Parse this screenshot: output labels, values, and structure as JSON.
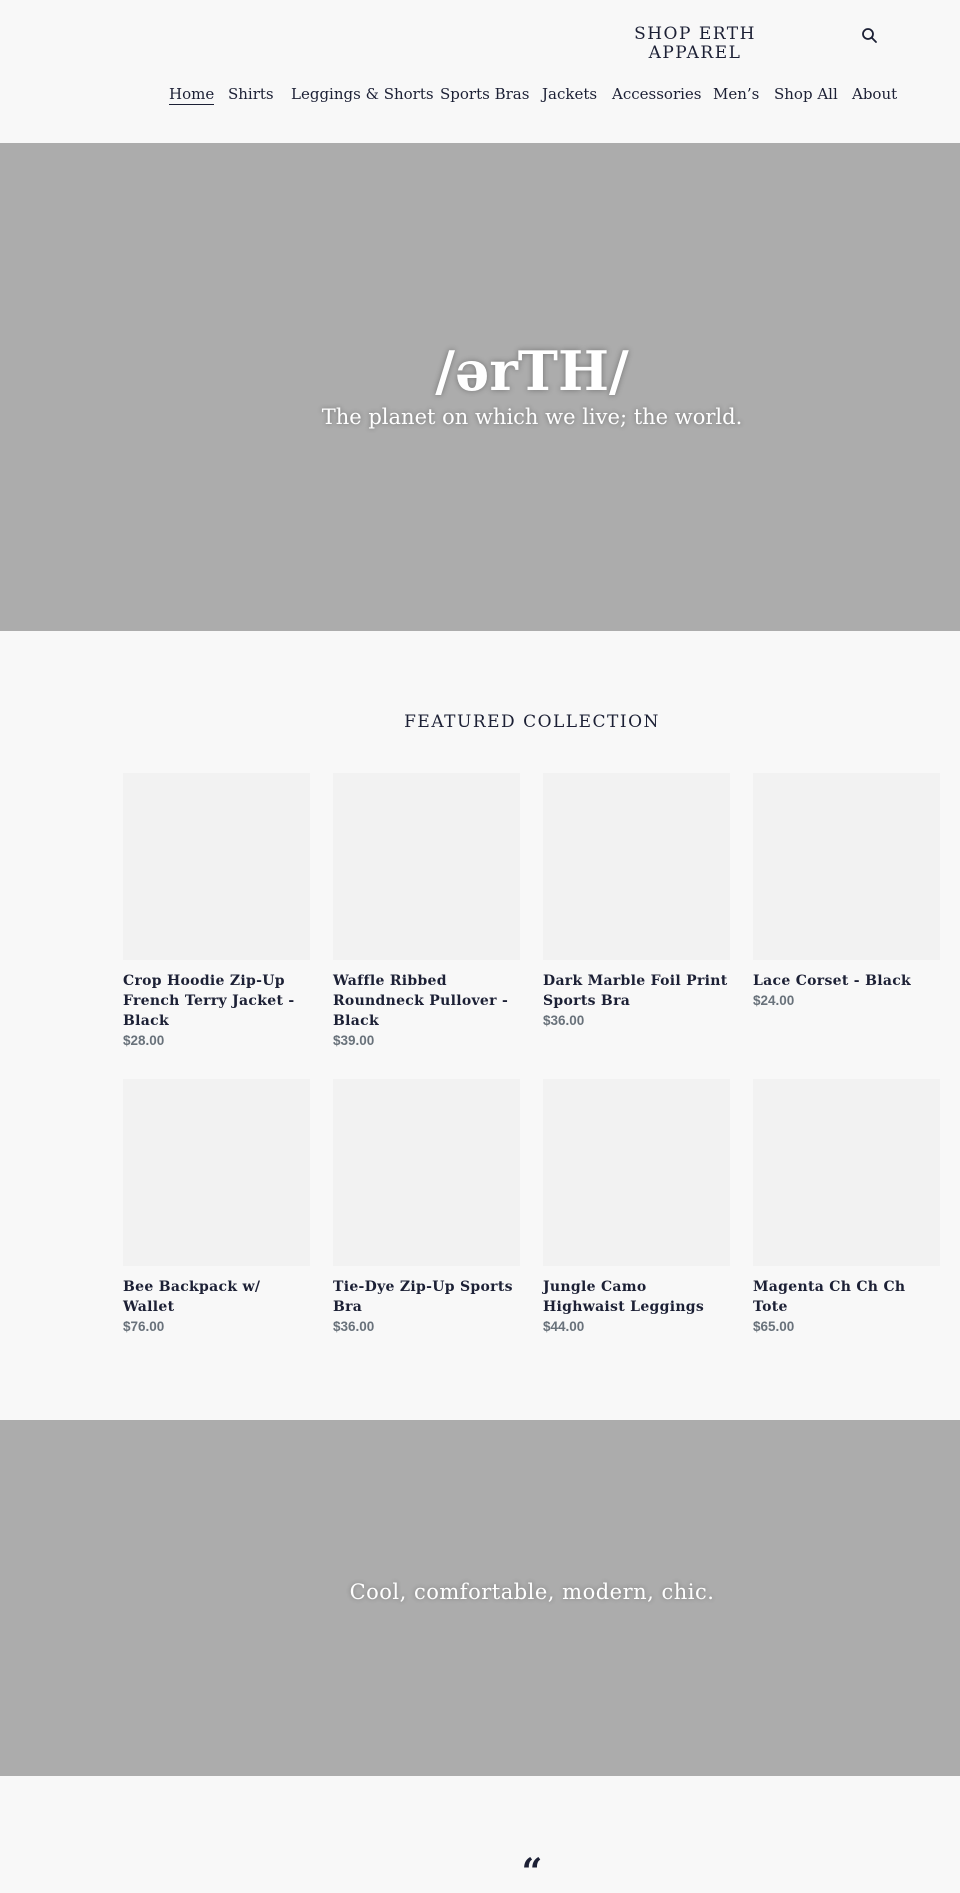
{
  "header": {
    "logo": "SHOP ERTH APPAREL",
    "search_icon": "search-icon"
  },
  "nav": {
    "items": [
      {
        "label": "Home",
        "active": true
      },
      {
        "label": "Shirts"
      },
      {
        "label": "Leggings & Shorts"
      },
      {
        "label": "Sports Bras"
      },
      {
        "label": "Jackets"
      },
      {
        "label": "Accessories"
      },
      {
        "label": "Men’s"
      },
      {
        "label": "Shop All"
      },
      {
        "label": "About"
      }
    ]
  },
  "hero": {
    "title": "/ərTH/",
    "subtitle": "The planet on which we live; the world."
  },
  "featured": {
    "heading": "FEATURED COLLECTION",
    "products": [
      {
        "title": "Crop Hoodie Zip-Up French Terry Jacket - Black",
        "price": "$28.00"
      },
      {
        "title": "Waffle Ribbed Roundneck Pullover - Black",
        "price": "$39.00"
      },
      {
        "title": "Dark Marble Foil Print Sports Bra",
        "price": "$36.00"
      },
      {
        "title": "Lace Corset - Black",
        "price": "$24.00"
      },
      {
        "title": "Bee Backpack w/ Wallet",
        "price": "$76.00"
      },
      {
        "title": "Tie-Dye Zip-Up Sports Bra",
        "price": "$36.00"
      },
      {
        "title": "Jungle Camo Highwaist Leggings",
        "price": "$44.00"
      },
      {
        "title": "Magenta Ch Ch Ch Tote",
        "price": "$65.00"
      }
    ]
  },
  "banner": {
    "text": "Cool, comfortable, modern, chic."
  },
  "testimonial": {
    "quote_mark": "“"
  },
  "colors": {
    "text": "#1c2035",
    "background": "#f8f8f8",
    "hero_bg": "#acacac",
    "placeholder": "#f2f2f2",
    "price": "#69727b"
  }
}
